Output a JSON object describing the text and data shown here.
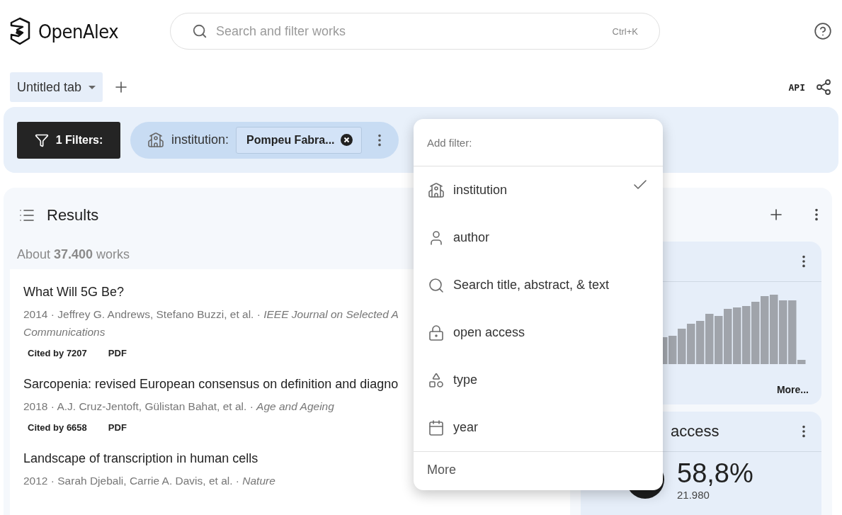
{
  "app": {
    "name": "OpenAlex"
  },
  "search": {
    "placeholder": "Search and filter works",
    "shortcut": "Ctrl+K"
  },
  "tabs": [
    {
      "label": "Untitled tab",
      "selected": true
    }
  ],
  "toolbar": {
    "api_label": "API"
  },
  "filters": {
    "button_label": "1 Filters:",
    "chips": [
      {
        "field": "institution:",
        "value": "Pompeu Fabra..."
      }
    ]
  },
  "results": {
    "title": "Results",
    "count": "About **37.400** works",
    "works": [
      {
        "title": "What Will 5G Be?",
        "meta": "2014 · Jeffrey G. Andrews, Stefano Buzzi, et al. · *IEEE Journal on Selected A Communications*",
        "cited": "Cited by 7207",
        "pdf": "PDF"
      },
      {
        "title": "Sarcopenia: revised European consensus on definition and diagno",
        "meta": "2018 · A.J. Cruz-Jentoft, Gülistan Bahat, et al. · *Age and Ageing*",
        "cited": "Cited by 6658",
        "pdf": "PDF"
      },
      {
        "title": "Landscape of transcription in human cells",
        "meta": "2012 · Sarah Djebali, Carrie A. Davis, et al. · *Nature*"
      }
    ]
  },
  "side_panel": {
    "cards": [
      {
        "kind": "histogram",
        "link": "More..."
      },
      {
        "kind": "percent",
        "title": "access",
        "value": "58,8%",
        "count": "21.980"
      }
    ]
  },
  "filter_menu": {
    "header": "Add filter:",
    "items": [
      {
        "kind": "institution",
        "label": "institution",
        "checked": true
      },
      {
        "kind": "author",
        "label": "author",
        "checked": false
      },
      {
        "kind": "search",
        "label": "Search title, abstract, & text",
        "checked": false
      },
      {
        "kind": "open_access",
        "label": "open access",
        "checked": false
      },
      {
        "kind": "type",
        "label": "type",
        "checked": false
      },
      {
        "kind": "year",
        "label": "year",
        "checked": false
      }
    ],
    "more": "More"
  }
}
